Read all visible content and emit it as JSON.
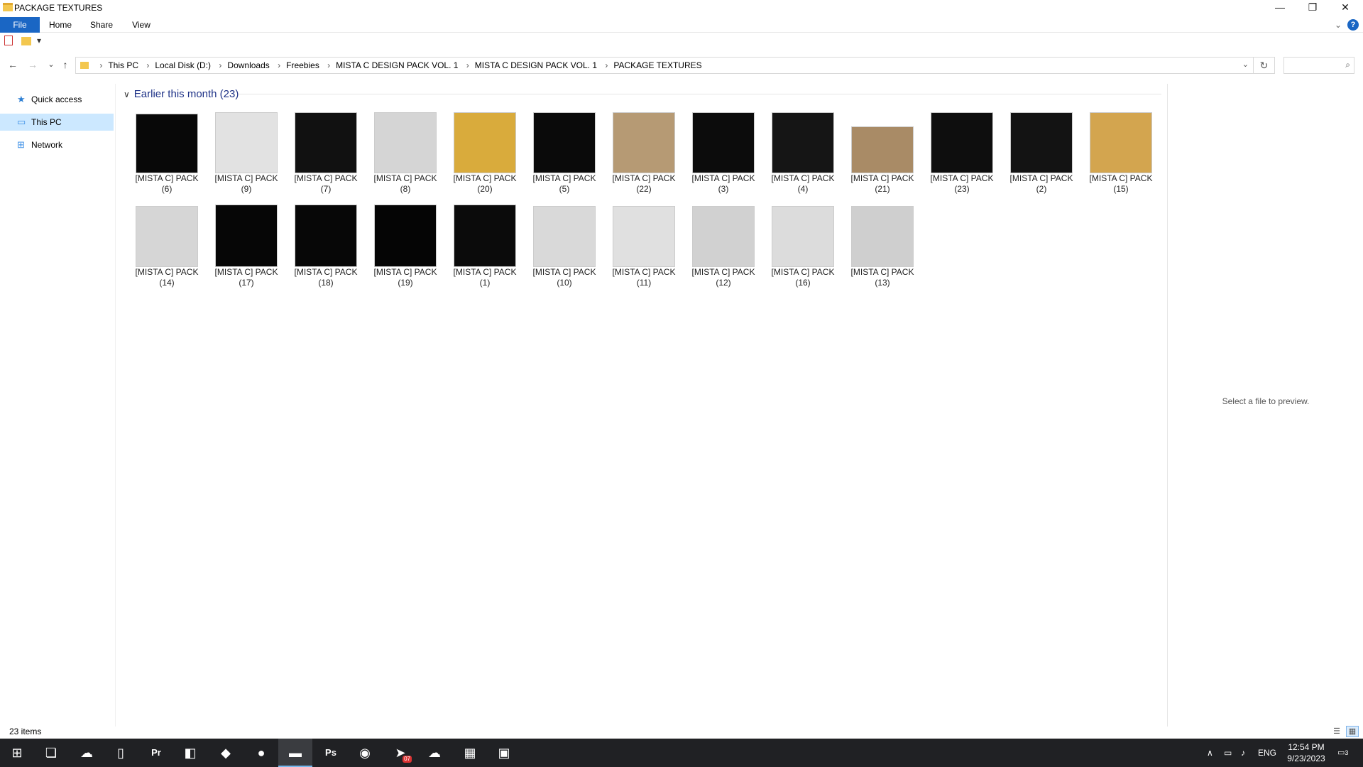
{
  "window": {
    "title": "PACKAGE TEXTURES",
    "minimize": "—",
    "maximize": "❐",
    "close": "✕"
  },
  "ribbon": {
    "tabs": [
      "File",
      "Home",
      "Share",
      "View"
    ],
    "help": "?",
    "expand": "⌄"
  },
  "qat": {
    "dropdown": "▾"
  },
  "nav": {
    "back": "←",
    "forward": "→",
    "recent": "⌄",
    "up": "↑",
    "breadcrumb": [
      "This PC",
      "Local Disk (D:)",
      "Downloads",
      "Freebies",
      "MISTA C DESIGN PACK VOL. 1",
      "MISTA C DESIGN PACK VOL. 1",
      "PACKAGE TEXTURES"
    ],
    "dropdown": "⌄",
    "refresh": "↻",
    "search_icon": "⌕"
  },
  "sidebar": {
    "items": [
      {
        "label": "Quick access",
        "icon": "star-icon",
        "glyph": "★",
        "color": "#2d7fd3",
        "selected": false
      },
      {
        "label": "This PC",
        "icon": "computer-icon",
        "glyph": "▭",
        "color": "#3a8ee6",
        "selected": true
      },
      {
        "label": "Network",
        "icon": "network-icon",
        "glyph": "⊞",
        "color": "#3a8ee6",
        "selected": false
      }
    ]
  },
  "group": {
    "title": "Earlier this month (23)",
    "chevron": "∨"
  },
  "files": [
    {
      "line1": "[MISTA C] PACK",
      "line2": "(6)",
      "fill": "#080808",
      "h": 84
    },
    {
      "line1": "[MISTA C] PACK",
      "line2": "(9)",
      "fill": "#e2e2e2",
      "h": 86
    },
    {
      "line1": "[MISTA C] PACK",
      "line2": "(7)",
      "fill": "#111111",
      "h": 86
    },
    {
      "line1": "[MISTA C] PACK",
      "line2": "(8)",
      "fill": "#d5d5d5",
      "h": 86
    },
    {
      "line1": "[MISTA C] PACK",
      "line2": "(20)",
      "fill": "#d9ab3c",
      "h": 86
    },
    {
      "line1": "[MISTA C] PACK",
      "line2": "(5)",
      "fill": "#0a0a0a",
      "h": 86
    },
    {
      "line1": "[MISTA C] PACK",
      "line2": "(22)",
      "fill": "#b69a74",
      "h": 86
    },
    {
      "line1": "[MISTA C] PACK",
      "line2": "(3)",
      "fill": "#0c0c0c",
      "h": 86
    },
    {
      "line1": "[MISTA C] PACK",
      "line2": "(4)",
      "fill": "#151515",
      "h": 86
    },
    {
      "line1": "[MISTA C] PACK",
      "line2": "(21)",
      "fill": "#a98b66",
      "h": 66
    },
    {
      "line1": "[MISTA C] PACK",
      "line2": "(23)",
      "fill": "#0e0e0e",
      "h": 86
    },
    {
      "line1": "[MISTA C] PACK",
      "line2": "(2)",
      "fill": "#131313",
      "h": 86
    },
    {
      "line1": "[MISTA C] PACK",
      "line2": "(15)",
      "fill": "#d3a54f",
      "h": 86
    },
    {
      "line1": "[MISTA C] PACK",
      "line2": "(14)",
      "fill": "#d6d6d6",
      "h": 86
    },
    {
      "line1": "[MISTA C] PACK",
      "line2": "(17)",
      "fill": "#060606",
      "h": 88
    },
    {
      "line1": "[MISTA C] PACK",
      "line2": "(18)",
      "fill": "#070707",
      "h": 88
    },
    {
      "line1": "[MISTA C] PACK",
      "line2": "(19)",
      "fill": "#050505",
      "h": 88
    },
    {
      "line1": "[MISTA C] PACK",
      "line2": "(1)",
      "fill": "#0b0b0b",
      "h": 88
    },
    {
      "line1": "[MISTA C] PACK",
      "line2": "(10)",
      "fill": "#d9d9d9",
      "h": 86
    },
    {
      "line1": "[MISTA C] PACK",
      "line2": "(11)",
      "fill": "#e0e0e0",
      "h": 86
    },
    {
      "line1": "[MISTA C] PACK",
      "line2": "(12)",
      "fill": "#d1d1d1",
      "h": 86
    },
    {
      "line1": "[MISTA C] PACK",
      "line2": "(16)",
      "fill": "#dcdcdc",
      "h": 86
    },
    {
      "line1": "[MISTA C] PACK",
      "line2": "(13)",
      "fill": "#cfcfcf",
      "h": 86
    }
  ],
  "preview": {
    "text": "Select a file to preview."
  },
  "status": {
    "count": "23 items",
    "details_view": "☰",
    "icons_view": "▦"
  },
  "taskbar": {
    "apps": [
      {
        "name": "start-icon",
        "glyph": "⊞",
        "active": false
      },
      {
        "name": "task-view-icon",
        "glyph": "❏",
        "active": false
      },
      {
        "name": "cloud-app-icon",
        "glyph": "☁",
        "active": false
      },
      {
        "name": "notepad-icon",
        "glyph": "▯",
        "active": false
      },
      {
        "name": "premiere-icon",
        "glyph": "Pr",
        "active": false
      },
      {
        "name": "sticky-app-icon",
        "glyph": "◧",
        "active": false
      },
      {
        "name": "bird-app-icon",
        "glyph": "◆",
        "active": false
      },
      {
        "name": "spotify-icon",
        "glyph": "●",
        "active": false
      },
      {
        "name": "file-explorer-icon",
        "glyph": "▬",
        "active": true
      },
      {
        "name": "photoshop-icon",
        "glyph": "Ps",
        "active": false
      },
      {
        "name": "chrome-icon",
        "glyph": "◉",
        "active": false
      },
      {
        "name": "telegram-icon",
        "glyph": "➤",
        "active": false,
        "badge": "07"
      },
      {
        "name": "onedrive-icon",
        "glyph": "☁",
        "active": false
      },
      {
        "name": "calculator-icon",
        "glyph": "▦",
        "active": false
      },
      {
        "name": "remote-app-icon",
        "glyph": "▣",
        "active": false
      }
    ],
    "tray_chevron": "∧",
    "tray_net": "▭",
    "tray_volume": "♪",
    "lang": "ENG",
    "time": "12:54 PM",
    "date": "9/23/2023",
    "notifications": "3"
  }
}
